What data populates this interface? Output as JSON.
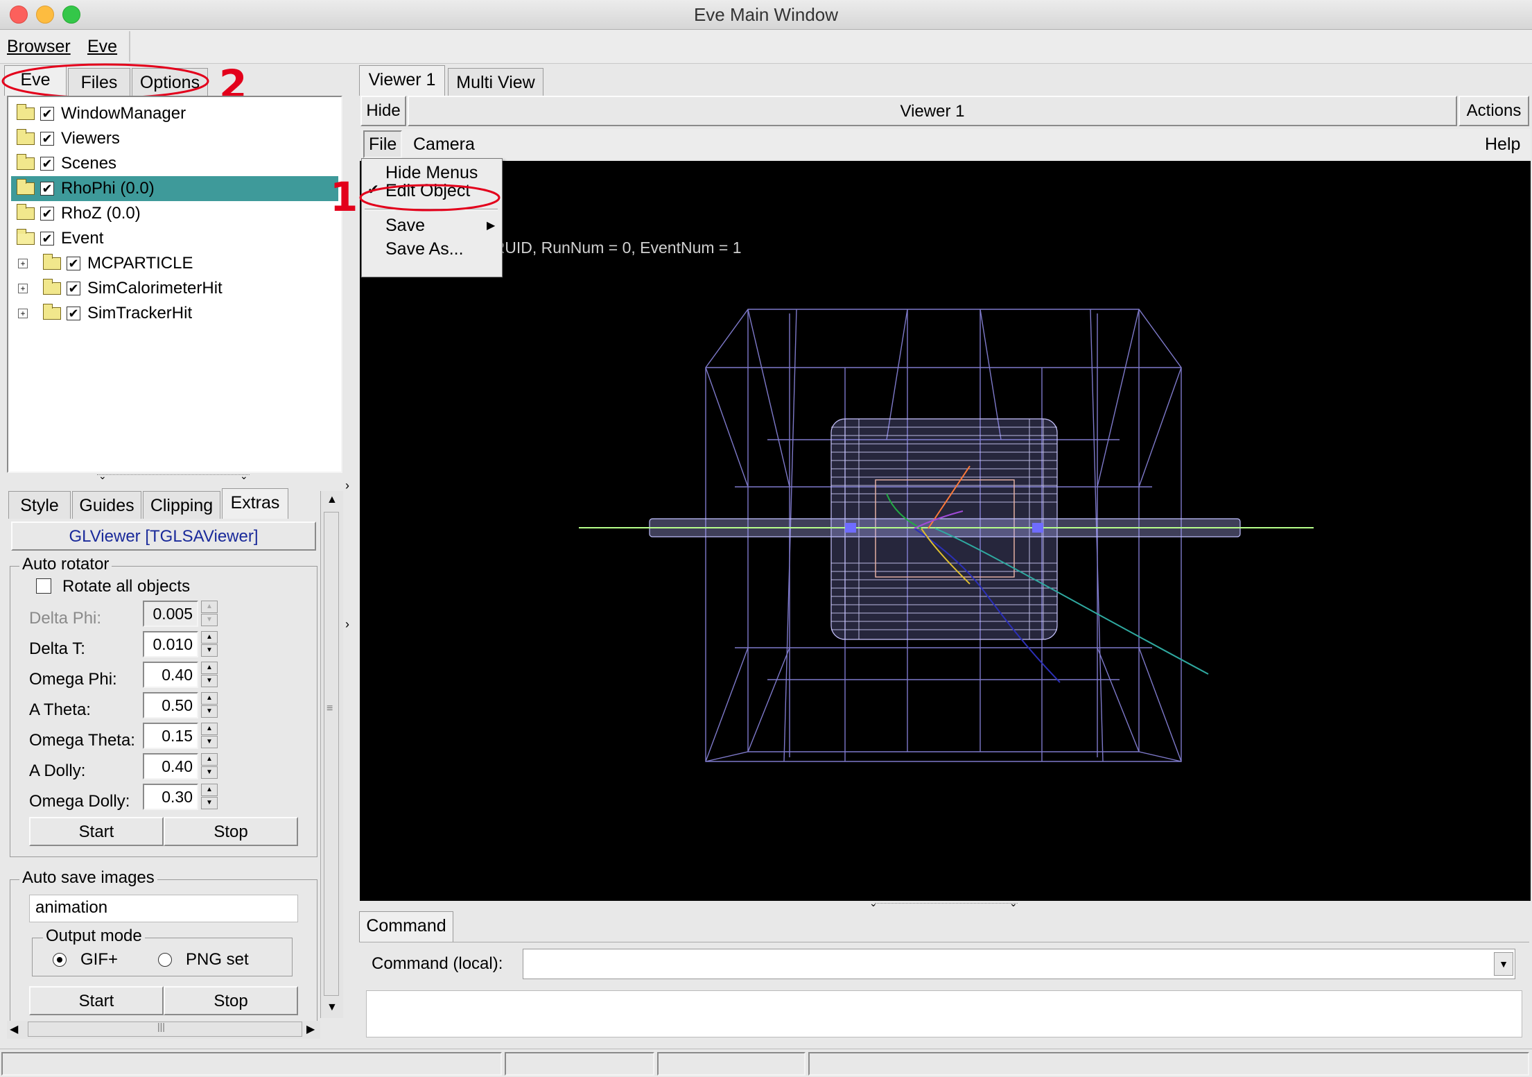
{
  "window": {
    "title": "Eve Main Window"
  },
  "menubar": {
    "items": [
      {
        "label": "Browser",
        "underline": "B"
      },
      {
        "label": "Eve",
        "underline": "E"
      }
    ]
  },
  "left_tabs": {
    "items": [
      "Eve",
      "Files",
      "Options"
    ],
    "active": "Eve"
  },
  "tree": {
    "items": [
      {
        "label": "WindowManager",
        "checked": true,
        "level": 0
      },
      {
        "label": "Viewers",
        "checked": true,
        "level": 0
      },
      {
        "label": "Scenes",
        "checked": true,
        "level": 0
      },
      {
        "label": "RhoPhi (0.0)",
        "checked": true,
        "level": 0,
        "selected": true
      },
      {
        "label": "RhoZ (0.0)",
        "checked": true,
        "level": 0
      },
      {
        "label": "Event",
        "checked": true,
        "level": 0,
        "open": true
      },
      {
        "label": "MCPARTICLE",
        "checked": true,
        "level": 1
      },
      {
        "label": "SimCalorimeterHit",
        "checked": true,
        "level": 1
      },
      {
        "label": "SimTrackerHit",
        "checked": true,
        "level": 1
      }
    ]
  },
  "editor_tabs": {
    "items": [
      "Style",
      "Guides",
      "Clipping",
      "Extras"
    ],
    "active": "Extras"
  },
  "editor": {
    "object_name": "GLViewer [TGLSAViewer]",
    "auto_rotator": {
      "label": "Auto rotator",
      "rotate_all_label": "Rotate all objects",
      "rotate_all_checked": false,
      "fields": [
        {
          "label": "Delta Phi:",
          "value": "0.005",
          "disabled": true
        },
        {
          "label": "Delta T:",
          "value": "0.010"
        },
        {
          "label": "Omega Phi:",
          "value": "0.40"
        },
        {
          "label": "A Theta:",
          "value": "0.50"
        },
        {
          "label": "Omega Theta:",
          "value": "0.15"
        },
        {
          "label": "A Dolly:",
          "value": "0.40"
        },
        {
          "label": "Omega Dolly:",
          "value": "0.30"
        }
      ],
      "start_label": "Start",
      "stop_label": "Stop"
    },
    "auto_save": {
      "label": "Auto save images",
      "filename": "animation",
      "output_mode_label": "Output mode",
      "mode_gif": "GIF+",
      "mode_png": "PNG set",
      "selected_mode": "GIF+",
      "start_label": "Start",
      "stop_label": "Stop"
    }
  },
  "viewer_tabs": {
    "items": [
      "Viewer 1",
      "Multi View"
    ],
    "active": "Viewer 1"
  },
  "viewer": {
    "hide_label": "Hide",
    "title": "Viewer 1",
    "actions_label": "Actions",
    "menu": {
      "file": "File",
      "camera": "Camera",
      "help": "Help"
    },
    "overlay_text": "DRUID, RunNum = 0, EventNum = 1"
  },
  "file_menu": {
    "items": [
      {
        "label": "Hide Menus",
        "underline": "H",
        "checked": false
      },
      {
        "label": "Edit Object",
        "underline": "E",
        "checked": true
      },
      {
        "label": "Save",
        "underline": "S",
        "submenu": true
      },
      {
        "label": "Save As...",
        "underline": "A"
      }
    ]
  },
  "annotations": {
    "marker_1": "1",
    "marker_2": "2",
    "color": "#e3001b"
  },
  "command": {
    "tab": "Command",
    "label": "Command (local):",
    "value": ""
  },
  "colors": {
    "selection": "#3e9a9a",
    "viewport": "#000000",
    "wire": "#9a96e8"
  }
}
